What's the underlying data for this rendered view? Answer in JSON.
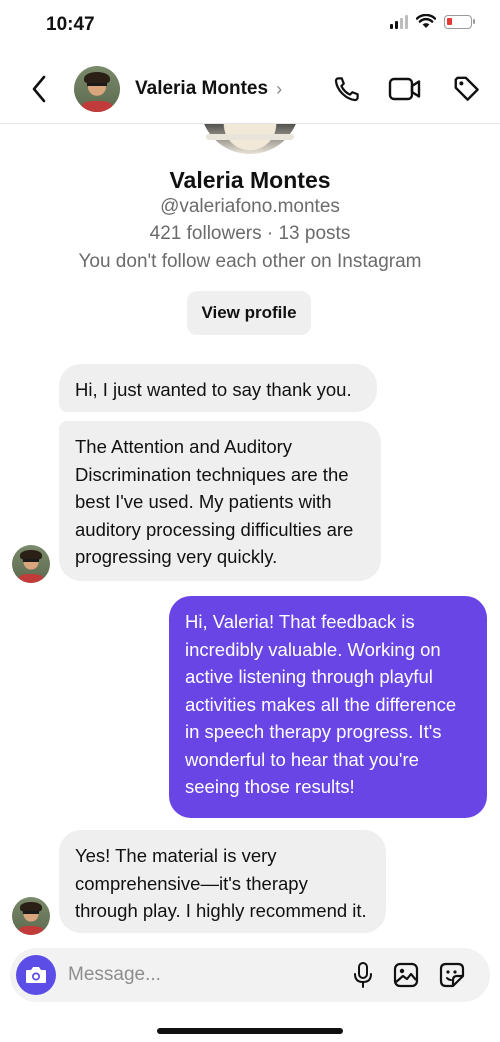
{
  "status_bar": {
    "time": "10:47"
  },
  "header": {
    "contact_name": "Valeria Montes",
    "chevron": "›",
    "icons": [
      "back-arrow-icon",
      "phone-icon",
      "video-camera-icon",
      "tag-icon"
    ]
  },
  "profile": {
    "name": "Valeria Montes",
    "handle": "@valeriafono.montes",
    "stats": "421 followers · 13 posts",
    "note": "You don't follow each other on Instagram",
    "view_profile_label": "View profile"
  },
  "messages": [
    {
      "direction": "incoming",
      "text": "Hi, I just wanted to say thank you."
    },
    {
      "direction": "incoming",
      "text": "The Attention and Auditory Discrimination techniques are the best I've used. My patients with auditory processing difficulties are progressing very quickly."
    },
    {
      "direction": "outgoing",
      "text": "Hi, Valeria! That feedback is incredibly valuable. Working on active listening through playful activities makes all the difference in speech therapy progress. It's wonderful to hear that you're seeing those results!"
    },
    {
      "direction": "incoming",
      "text": "Yes! The material is very comprehensive—it's therapy through play. I highly recommend it."
    }
  ],
  "composer": {
    "placeholder": "Message...",
    "icons": [
      "camera-icon",
      "microphone-icon",
      "gallery-icon",
      "sticker-icon"
    ]
  },
  "colors": {
    "accent": "#6a45e6",
    "camera_button": "#5b4de6",
    "incoming_bubble": "#efefef",
    "battery_low": "#e53935"
  }
}
